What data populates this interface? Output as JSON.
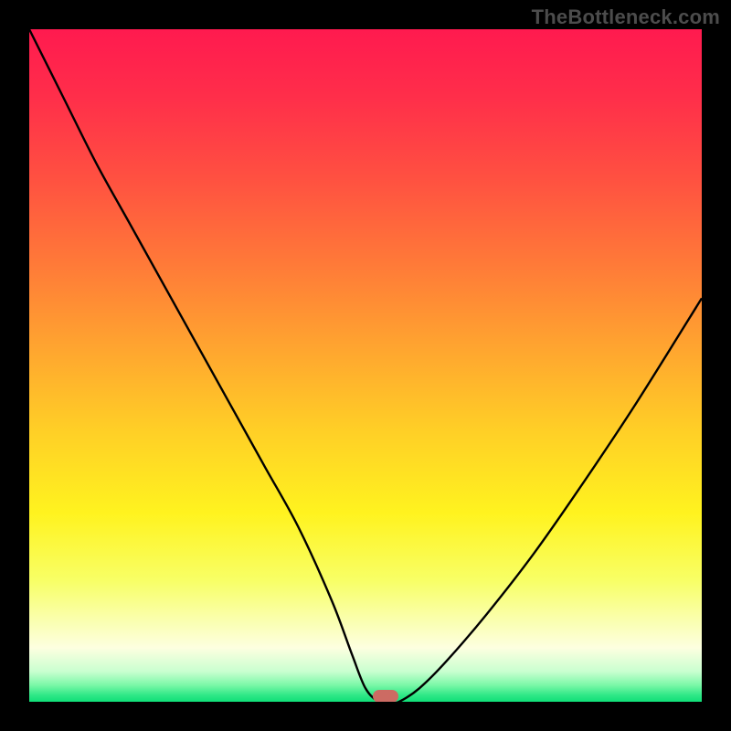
{
  "watermark": "TheBottleneck.com",
  "colors": {
    "gradient_stops": [
      {
        "offset": 0.0,
        "color": "#ff1a4f"
      },
      {
        "offset": 0.1,
        "color": "#ff2e4a"
      },
      {
        "offset": 0.22,
        "color": "#ff5041"
      },
      {
        "offset": 0.35,
        "color": "#ff7a38"
      },
      {
        "offset": 0.48,
        "color": "#ffa72f"
      },
      {
        "offset": 0.6,
        "color": "#ffd026"
      },
      {
        "offset": 0.72,
        "color": "#fff31f"
      },
      {
        "offset": 0.82,
        "color": "#f8ff66"
      },
      {
        "offset": 0.88,
        "color": "#faffb0"
      },
      {
        "offset": 0.92,
        "color": "#fdffe0"
      },
      {
        "offset": 0.955,
        "color": "#c9ffd0"
      },
      {
        "offset": 0.975,
        "color": "#7cf8a8"
      },
      {
        "offset": 0.99,
        "color": "#30e887"
      },
      {
        "offset": 1.0,
        "color": "#10df78"
      }
    ],
    "curve": "#000000",
    "marker": "#cc6b63",
    "frame": "#000000"
  },
  "chart_data": {
    "type": "line",
    "title": "",
    "xlabel": "",
    "ylabel": "",
    "xlim": [
      0,
      100
    ],
    "ylim": [
      0,
      100
    ],
    "series": [
      {
        "name": "bottleneck-curve",
        "x": [
          0,
          5,
          10,
          15,
          20,
          25,
          30,
          35,
          40,
          45,
          48,
          50,
          52,
          54,
          55,
          58,
          62,
          68,
          75,
          82,
          90,
          100
        ],
        "y": [
          100,
          90,
          80,
          71,
          62,
          53,
          44,
          35,
          26,
          15,
          7,
          2,
          0,
          0,
          0,
          2,
          6,
          13,
          22,
          32,
          44,
          60
        ]
      }
    ],
    "annotations": [
      {
        "name": "optimum-marker",
        "x": 53,
        "y": 0.8
      }
    ]
  }
}
